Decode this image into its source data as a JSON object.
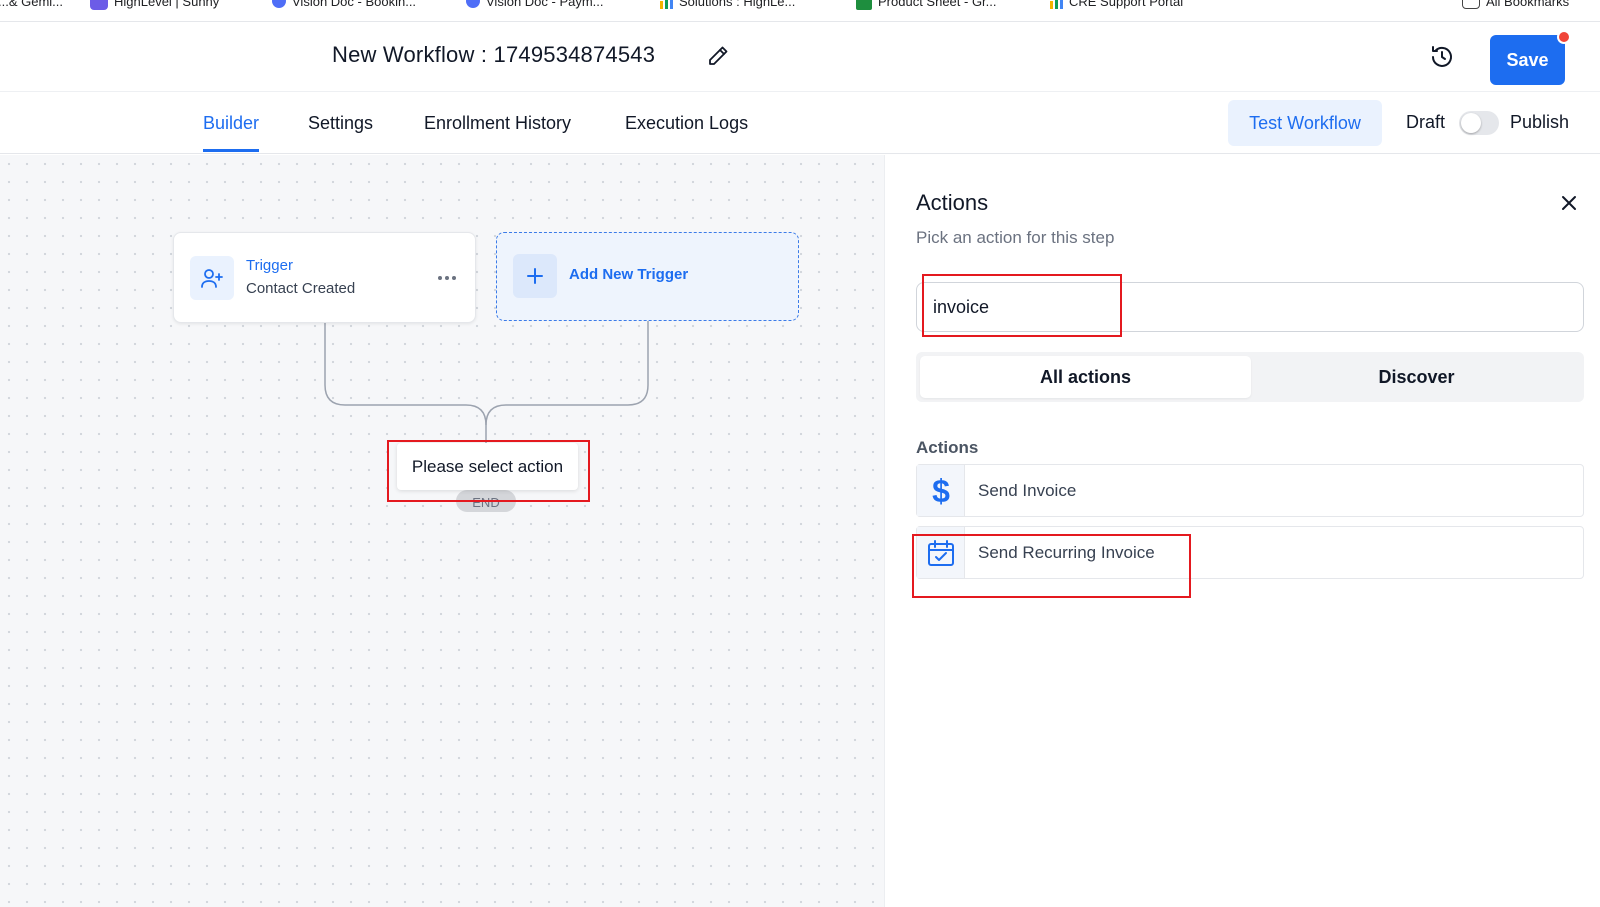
{
  "bookmarks": [
    {
      "label": "...& Gemi..."
    },
    {
      "label": "HighLevel | Sunny"
    },
    {
      "label": "Vision Doc - Bookin..."
    },
    {
      "label": "Vision Doc - Paym..."
    },
    {
      "label": "Solutions : HighLe..."
    },
    {
      "label": "Product Sheet - Gr..."
    },
    {
      "label": "CRE Support Portal"
    },
    {
      "label": "All Bookmarks"
    }
  ],
  "header": {
    "title": "New Workflow : 1749534874543",
    "save_label": "Save"
  },
  "tabs": [
    {
      "label": "Builder",
      "active": true
    },
    {
      "label": "Settings",
      "active": false
    },
    {
      "label": "Enrollment History",
      "active": false
    },
    {
      "label": "Execution Logs",
      "active": false
    }
  ],
  "toolbar": {
    "test_label": "Test Workflow",
    "draft_label": "Draft",
    "publish_label": "Publish",
    "published": false
  },
  "canvas": {
    "trigger": {
      "title": "Trigger",
      "subtitle": "Contact Created"
    },
    "add_trigger_label": "Add New Trigger",
    "select_action_label": "Please select action",
    "end_label": "END"
  },
  "panel": {
    "title": "Actions",
    "subtitle": "Pick an action for this step",
    "search_value": "invoice",
    "segments": [
      {
        "label": "All actions",
        "active": true
      },
      {
        "label": "Discover",
        "active": false
      }
    ],
    "section_label": "Actions",
    "actions": [
      {
        "label": "Send Invoice",
        "icon": "dollar-icon"
      },
      {
        "label": "Send Recurring Invoice",
        "icon": "calendar-check-icon"
      }
    ]
  },
  "colors": {
    "accent": "#1d6df0",
    "highlight": "#e4191f",
    "notification": "#f04438"
  }
}
